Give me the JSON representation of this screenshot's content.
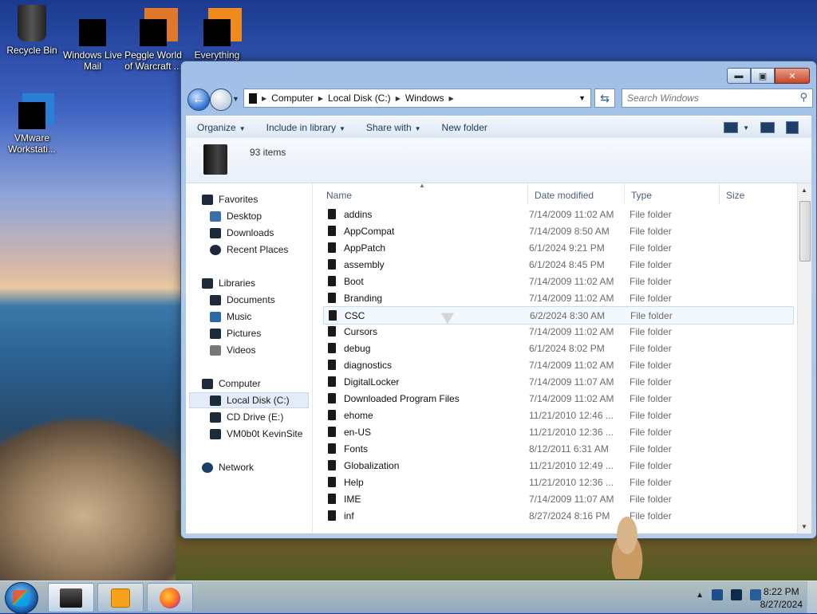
{
  "desktop": {
    "icons": [
      {
        "label": "Recycle Bin"
      },
      {
        "label": "Windows Live Mail"
      },
      {
        "label": "Peggle World of Warcraft ..."
      },
      {
        "label": "Everything"
      },
      {
        "label": "VMware Workstati..."
      }
    ]
  },
  "window": {
    "address": {
      "segments": [
        "Computer",
        "Local Disk (C:)",
        "Windows"
      ]
    },
    "search": {
      "placeholder": "Search Windows"
    },
    "toolbar": {
      "organize": "Organize",
      "include_in_library": "Include in library",
      "share_with": "Share with",
      "new_folder": "New folder"
    },
    "item_count": "93 items",
    "nav": {
      "favorites": "Favorites",
      "desktop": "Desktop",
      "downloads": "Downloads",
      "recent_places": "Recent Places",
      "libraries": "Libraries",
      "documents": "Documents",
      "music": "Music",
      "pictures": "Pictures",
      "videos": "Videos",
      "computer": "Computer",
      "local_disk": "Local Disk (C:)",
      "cd_drive": "CD Drive (E:)",
      "vm_site": "VM0b0t KevinSite",
      "network": "Network"
    },
    "columns": {
      "name": "Name",
      "date": "Date modified",
      "type": "Type",
      "size": "Size"
    },
    "rows": [
      {
        "name": "addins",
        "date": "7/14/2009 11:02 AM",
        "type": "File folder"
      },
      {
        "name": "AppCompat",
        "date": "7/14/2009 8:50 AM",
        "type": "File folder"
      },
      {
        "name": "AppPatch",
        "date": "6/1/2024 9:21 PM",
        "type": "File folder"
      },
      {
        "name": "assembly",
        "date": "6/1/2024 8:45 PM",
        "type": "File folder"
      },
      {
        "name": "Boot",
        "date": "7/14/2009 11:02 AM",
        "type": "File folder"
      },
      {
        "name": "Branding",
        "date": "7/14/2009 11:02 AM",
        "type": "File folder"
      },
      {
        "name": "CSC",
        "date": "6/2/2024 8:30 AM",
        "type": "File folder"
      },
      {
        "name": "Cursors",
        "date": "7/14/2009 11:02 AM",
        "type": "File folder"
      },
      {
        "name": "debug",
        "date": "6/1/2024 8:02 PM",
        "type": "File folder"
      },
      {
        "name": "diagnostics",
        "date": "7/14/2009 11:02 AM",
        "type": "File folder"
      },
      {
        "name": "DigitalLocker",
        "date": "7/14/2009 11:07 AM",
        "type": "File folder"
      },
      {
        "name": "Downloaded Program Files",
        "date": "7/14/2009 11:02 AM",
        "type": "File folder"
      },
      {
        "name": "ehome",
        "date": "11/21/2010 12:46 ...",
        "type": "File folder"
      },
      {
        "name": "en-US",
        "date": "11/21/2010 12:36 ...",
        "type": "File folder"
      },
      {
        "name": "Fonts",
        "date": "8/12/2011 6:31 AM",
        "type": "File folder"
      },
      {
        "name": "Globalization",
        "date": "11/21/2010 12:49 ...",
        "type": "File folder"
      },
      {
        "name": "Help",
        "date": "11/21/2010 12:36 ...",
        "type": "File folder"
      },
      {
        "name": "IME",
        "date": "7/14/2009 11:07 AM",
        "type": "File folder"
      },
      {
        "name": "inf",
        "date": "8/27/2024 8:16 PM",
        "type": "File folder"
      }
    ]
  },
  "taskbar": {
    "time": "8:22 PM",
    "date": "8/27/2024"
  }
}
